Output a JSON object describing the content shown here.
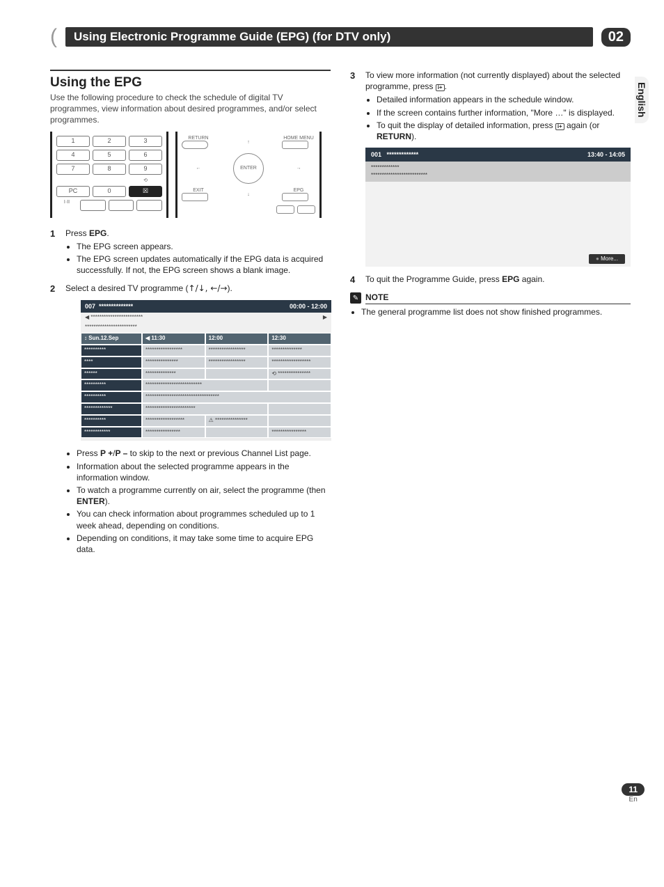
{
  "chapter": {
    "title": "Using Electronic Programme Guide (EPG) (for DTV only)",
    "number": "02"
  },
  "side_tab": "English",
  "page_number_badge": "11",
  "page_number_sub": "En",
  "left": {
    "section_title": "Using the EPG",
    "intro": "Use the following procedure to check the schedule of digital TV programmes, view information about desired programmes, and/or select programmes.",
    "remote_numpad": [
      "1",
      "2",
      "3",
      "4",
      "5",
      "6",
      "7",
      "8",
      "9",
      "PC",
      "0",
      "☒"
    ],
    "remote_numpad_sub_second_last": "⟲",
    "remote_bottom_row": "I·II",
    "remote_right": {
      "return": "RETURN",
      "home_menu": "HOME MENU",
      "enter": "ENTER",
      "exit": "EXIT",
      "epg": "EPG"
    },
    "step1": {
      "text_prefix": "Press ",
      "text_strong": "EPG",
      "text_suffix": ".",
      "b1": "The EPG screen appears.",
      "b2": "The EPG screen updates automatically if the EPG data is acquired successfully. If not, the EPG screen shows a blank image."
    },
    "step2": {
      "text_prefix": "Select a desired TV programme (",
      "arrows": "↑/↓, ←/→",
      "text_suffix": ").",
      "epg": {
        "ch_label": "007",
        "ch_name": "**************",
        "time_range": "00:00 - 12:00",
        "sub1": "◀ ************************",
        "sub1_right": "▶",
        "sub2": "************************",
        "date_col": "Sun.12.Sep",
        "t1": "◀ 11:30",
        "t2": "12:00",
        "t3": "12:30",
        "channels": [
          "**********",
          "****",
          "******",
          "**********",
          "**********",
          "*************",
          "**********",
          "************"
        ]
      },
      "b1": "Press P +/P – to skip to the next or previous Channel List page.",
      "b2": "Information about the selected programme appears in the information window.",
      "b3_pre": "To watch a programme currently on air, select the programme (then ",
      "b3_strong": "ENTER",
      "b3_post": ").",
      "b4": "You can check information about programmes scheduled up to 1 week ahead, depending on conditions.",
      "b5": "Depending on conditions, it may take some time to acquire EPG data."
    }
  },
  "right": {
    "step3": {
      "text_pre": "To view more information (not currently displayed) about the selected programme, press ",
      "info_icon": "i+",
      "text_post": ".",
      "b1": "Detailed information appears in the schedule window.",
      "b2": "If the screen contains further information, \"More …\" is displayed.",
      "b3_pre": "To quit the display of detailed information, press ",
      "b3_mid": " again (or ",
      "b3_strong": "RETURN",
      "b3_post": ").",
      "detail": {
        "ch": "001",
        "ch_name": "*************",
        "time": "13:40 - 14:05",
        "line1": "*************",
        "line2": "**************************",
        "more": "More..."
      }
    },
    "step4": {
      "text_pre": "To quit the Programme Guide, press ",
      "text_strong": "EPG",
      "text_post": " again."
    },
    "note_label": "NOTE",
    "note_bullet": "The general programme list does not show finished programmes."
  }
}
